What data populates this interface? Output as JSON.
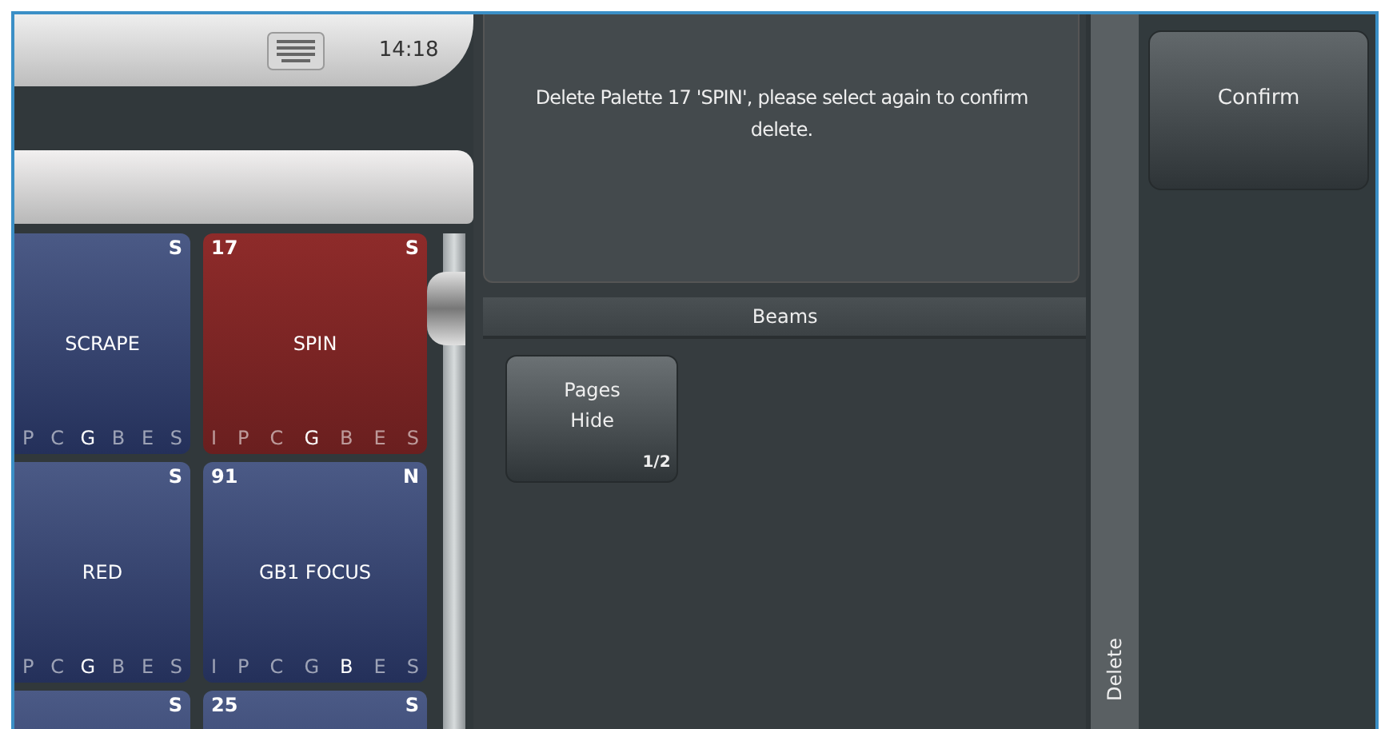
{
  "top_bar": {
    "clock": "14:18"
  },
  "palettes": [
    {
      "code": "S",
      "name": "SCRAPE",
      "selected": false,
      "attributes": [
        {
          "letter": "P",
          "on": false
        },
        {
          "letter": "C",
          "on": false
        },
        {
          "letter": "G",
          "on": true
        },
        {
          "letter": "B",
          "on": false
        },
        {
          "letter": "E",
          "on": false
        },
        {
          "letter": "S",
          "on": false
        }
      ]
    },
    {
      "number": "17",
      "code": "S",
      "name": "SPIN",
      "selected": true,
      "attributes": [
        {
          "letter": "I",
          "on": false
        },
        {
          "letter": "P",
          "on": false
        },
        {
          "letter": "C",
          "on": false
        },
        {
          "letter": "G",
          "on": true
        },
        {
          "letter": "B",
          "on": false
        },
        {
          "letter": "E",
          "on": false
        },
        {
          "letter": "S",
          "on": false
        }
      ]
    },
    {
      "code": "S",
      "name": "RED",
      "selected": false,
      "attributes": [
        {
          "letter": "P",
          "on": false
        },
        {
          "letter": "C",
          "on": false
        },
        {
          "letter": "G",
          "on": true
        },
        {
          "letter": "B",
          "on": false
        },
        {
          "letter": "E",
          "on": false
        },
        {
          "letter": "S",
          "on": false
        }
      ]
    },
    {
      "number": "91",
      "code": "N",
      "name": "GB1 FOCUS",
      "selected": false,
      "attributes": [
        {
          "letter": "I",
          "on": false
        },
        {
          "letter": "P",
          "on": false
        },
        {
          "letter": "C",
          "on": false
        },
        {
          "letter": "G",
          "on": false
        },
        {
          "letter": "B",
          "on": true
        },
        {
          "letter": "E",
          "on": false
        },
        {
          "letter": "S",
          "on": false
        }
      ]
    },
    {
      "code": "S",
      "selected": false
    },
    {
      "number": "25",
      "code": "S",
      "selected": false
    }
  ],
  "message": "Delete Palette 17 'SPIN', please select again to confirm delete.",
  "section": {
    "title": "Beams",
    "buttons": [
      {
        "label": "Pages\nHide",
        "page": "1/2"
      }
    ]
  },
  "side_label": "Delete",
  "confirm": "Confirm"
}
